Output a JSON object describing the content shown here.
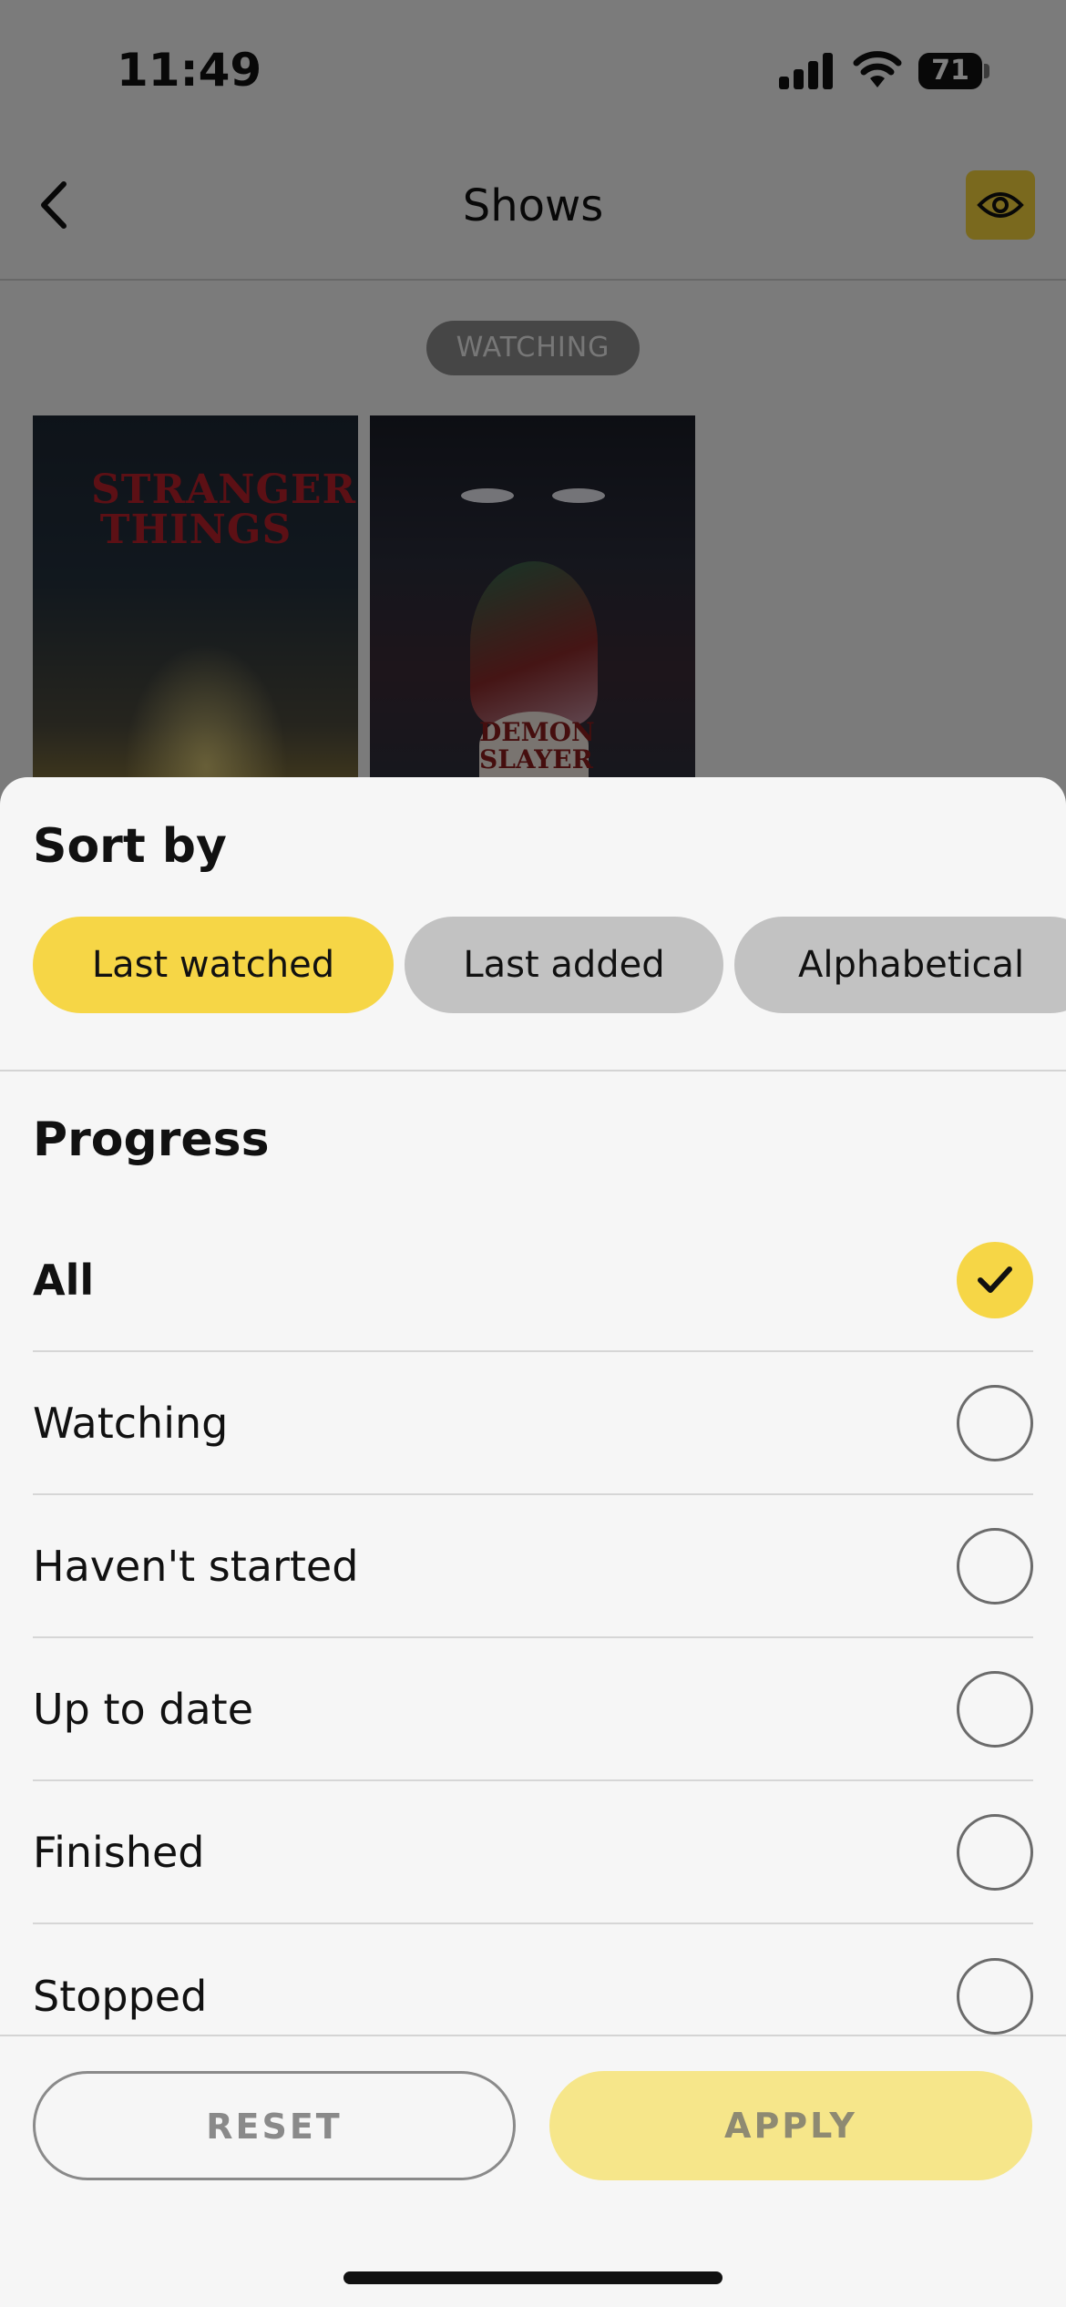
{
  "status_bar": {
    "time": "11:49",
    "battery": "71"
  },
  "nav": {
    "title": "Shows",
    "back_icon": "chevron-left-icon",
    "visibility_icon": "eye-icon"
  },
  "content": {
    "section_label": "WATCHING",
    "posters": [
      {
        "logo": "STRANGER THINGS"
      },
      {
        "logo": "DEMON SLAYER"
      }
    ]
  },
  "sheet": {
    "sort_title": "Sort by",
    "sort_options": [
      {
        "label": "Last watched",
        "active": true
      },
      {
        "label": "Last added",
        "active": false
      },
      {
        "label": "Alphabetical",
        "active": false
      }
    ],
    "progress_title": "Progress",
    "progress_options": [
      {
        "label": "All",
        "selected": true
      },
      {
        "label": "Watching",
        "selected": false
      },
      {
        "label": "Haven't started",
        "selected": false
      },
      {
        "label": "Up to date",
        "selected": false
      },
      {
        "label": "Finished",
        "selected": false
      },
      {
        "label": "Stopped",
        "selected": false
      }
    ],
    "reset_label": "RESET",
    "apply_label": "APPLY"
  },
  "colors": {
    "accent": "#f6d646",
    "apply_disabled": "#f6e68a",
    "sheet_background": "#f6f6f6"
  }
}
